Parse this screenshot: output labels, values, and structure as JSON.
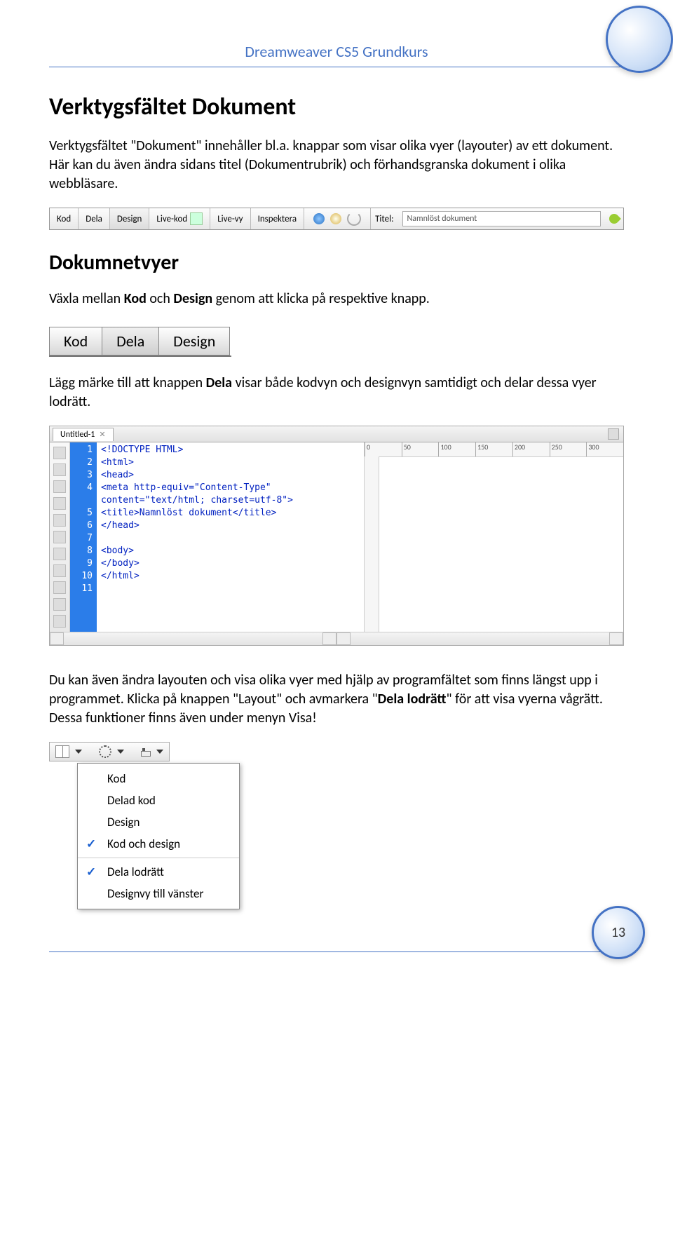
{
  "header": "Dreamweaver CS5 Grundkurs",
  "heading1": "Verktygsfältet Dokument",
  "para1": "Verktygsfältet \"Dokument\" innehåller bl.a. knappar som visar olika vyer (layouter) av ett dokument. Här kan du även ändra sidans titel (Dokumentrubrik) och förhandsgranska dokument i olika webbläsare.",
  "toolbar": {
    "kod": "Kod",
    "dela": "Dela",
    "design": "Design",
    "livekod": "Live-kod",
    "livevy": "Live-vy",
    "inspektera": "Inspektera",
    "titel_label": "Titel:",
    "titel_value": "Namnlöst dokument"
  },
  "heading2": "Dokumnetvyer",
  "para2_pre": "Växla mellan ",
  "para2_b1": "Kod",
  "para2_mid": " och ",
  "para2_b2": "Design",
  "para2_post": " genom att klicka på respektive knapp.",
  "btns": {
    "kod": "Kod",
    "dela": "Dela",
    "design": "Design"
  },
  "para3_pre": "Lägg märke till att knappen ",
  "para3_b": "Dela",
  "para3_post": " visar både kodvyn och designvyn samtidigt och delar dessa vyer lodrätt.",
  "codefig": {
    "tab": "Untitled-1",
    "lines": [
      "1",
      "2",
      "3",
      "4",
      "",
      "5",
      "6",
      "7",
      "8",
      "9",
      "10",
      "11"
    ],
    "code": "<!DOCTYPE HTML>\n<html>\n<head>\n<meta http-equiv=\"Content-Type\"\ncontent=\"text/html; charset=utf-8\">\n<title>Namnlöst dokument</title>\n</head>\n\n<body>\n</body>\n</html>",
    "ruler": [
      "0",
      "50",
      "100",
      "150",
      "200",
      "250",
      "300"
    ]
  },
  "para4_pre": "Du kan även ändra layouten och visa olika vyer med hjälp av programfältet som finns längst upp i programmet. Klicka på knappen \"Layout\" och avmarkera \"",
  "para4_b": "Dela lodrätt",
  "para4_post": "\" för att visa vyerna vågrätt. Dessa funktioner finns även under menyn Visa!",
  "menu": {
    "items": [
      {
        "chk": "",
        "label": "Kod"
      },
      {
        "chk": "",
        "label": "Delad kod"
      },
      {
        "chk": "",
        "label": "Design"
      },
      {
        "chk": "✓",
        "label": "Kod och design"
      }
    ],
    "items2": [
      {
        "chk": "✓",
        "label": "Dela lodrätt"
      },
      {
        "chk": "",
        "label": "Designvy till vänster"
      }
    ]
  },
  "page_num": "13"
}
